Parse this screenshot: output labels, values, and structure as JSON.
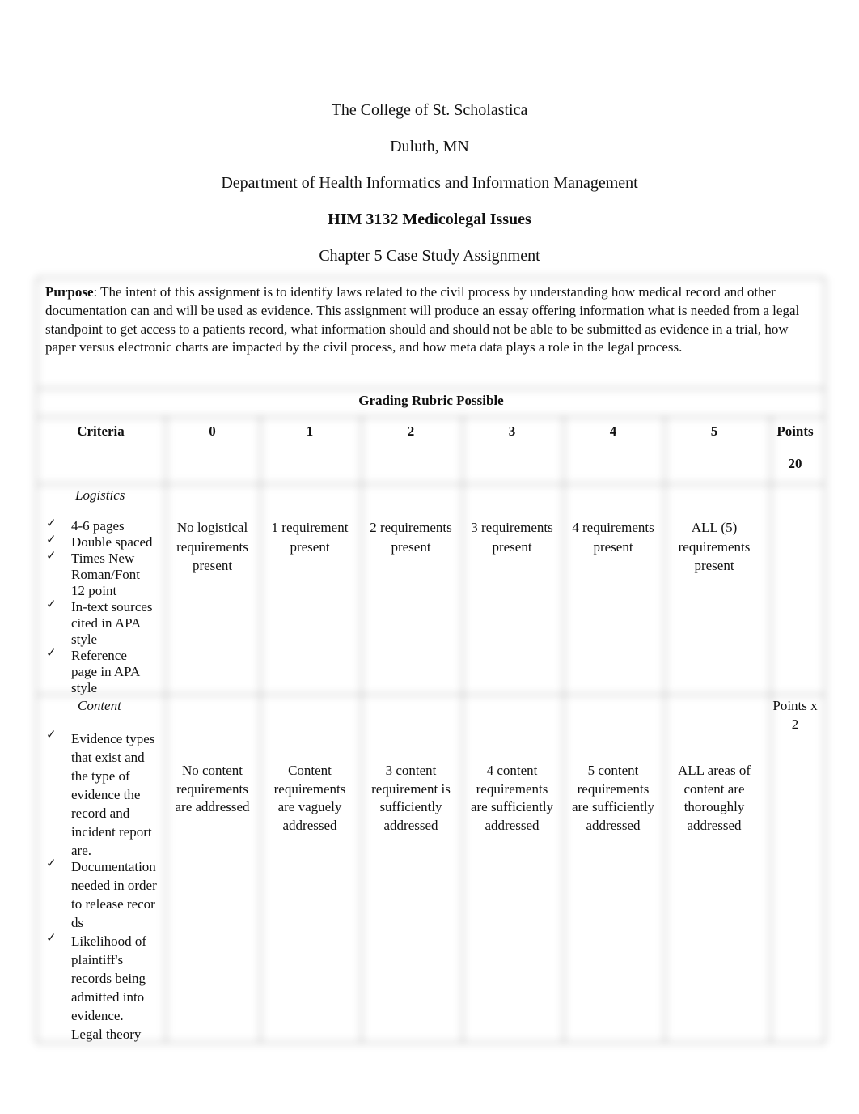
{
  "header": {
    "institution": "The College of St. Scholastica",
    "location": "Duluth, MN",
    "department": "Department of Health Informatics and Information Management",
    "course": "HIM 3132 Medicolegal Issues",
    "assignment": "Chapter 5 Case Study Assignment"
  },
  "purpose": {
    "label": "Purpose",
    "text": ":  The intent of this assignment is to identify laws related to the civil process by understanding how medical record and other documentation can and will be used as evidence.  This assignment will produce an essay offering information what is needed from a legal standpoint to get access to a patients record, what information should and should not be able to be submitted as evidence in a trial, how paper versus electronic charts are impacted by the civil process, and how meta data plays a role in the legal process."
  },
  "rubric": {
    "title": "Grading Rubric Possible",
    "columns": [
      "Criteria",
      "0",
      "1",
      "2",
      "3",
      "4",
      "5",
      "Points"
    ],
    "total_points": "20",
    "check_icon": "✓",
    "rows": [
      {
        "section": "Logistics",
        "items": [
          "4-6 pages",
          "Double spaced",
          "Times New Roman/Font 12 point",
          "In-text sources cited in APA style",
          "Reference page in APA style"
        ],
        "scores": [
          "No logistical requirements present",
          "1 requirement present",
          "2 requirements present",
          "3 requirements present",
          "4 requirements present",
          "ALL (5) requirements present"
        ],
        "points": ""
      },
      {
        "section": "Content",
        "items": [
          "Evidence types that exist and the type of evidence the record and incident report are.",
          "Documentation needed in order to release records",
          "Likelihood of plaintiff's records being admitted into evidence.",
          "Legal theory"
        ],
        "scores": [
          "No content requirements are addressed",
          "Content requirements are vaguely addressed",
          "3 content requirement is sufficiently addressed",
          "4 content requirements are sufficiently addressed",
          "5 content requirements are sufficiently addressed",
          "ALL areas of content are thoroughly addressed"
        ],
        "points": "Points x 2"
      }
    ]
  }
}
